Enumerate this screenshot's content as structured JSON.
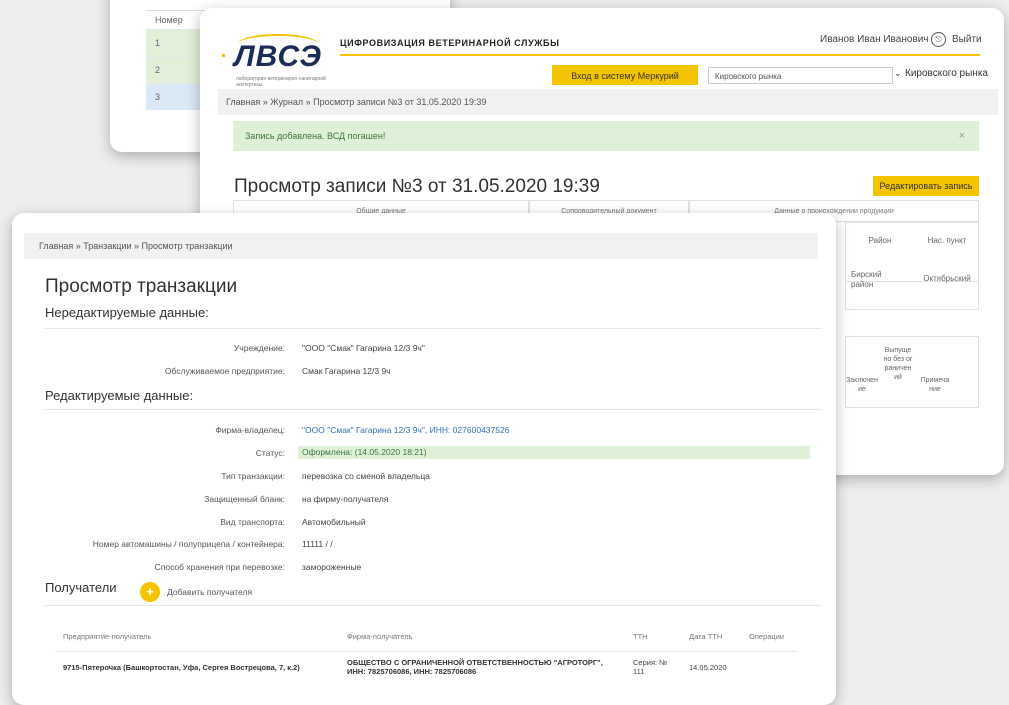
{
  "back_card": {
    "header": "Номер",
    "rows": [
      "1",
      "2",
      "3"
    ]
  },
  "middle_card": {
    "logo": {
      "text": "ЛВСЭ",
      "subtitle": "лаборатория ветеринарно-санитарной экспертизы"
    },
    "app_title": "ЦИФРОВИЗАЦИЯ ВЕТЕРИНАРНОЙ СЛУЖБЫ",
    "user_name": "Иванов Иван Иванович",
    "logout_label": "Выйти",
    "mercury_button": "Вход в систему Меркурий",
    "market_select_value": "Кировского рынка",
    "market_label": "Кировского рынка",
    "breadcrumb": "Главная  »  Журнал  »  Просмотр записи №3 от 31.05.2020 19:39",
    "alert": "Запись добавлена. ВСД погашен!",
    "alert_close": "×",
    "heading": "Просмотр записи №3 от 31.05.2020 19:39",
    "edit_button": "Редактировать запись",
    "table": {
      "group_headers": [
        "Общие данные",
        "Сопроводительный документ",
        "Данные о происхождении продукции"
      ],
      "col_region": "Район",
      "col_settlement": "Нас. пункт",
      "row_region": "Бирский район",
      "row_settlement": "Октябрьский",
      "col_conclusion": "Заключение",
      "col_released": "Выпущено без ограничений",
      "col_note": "Примечание"
    }
  },
  "front_card": {
    "breadcrumb": "Главная  »  Транзакции  »  Просмотр транзакции",
    "title": "Просмотр транзакции",
    "noneditable_heading": "Нередактируемые данные:",
    "editable_heading": "Редактируемые данные:",
    "fields": {
      "institution_label": "Учреждение:",
      "institution_value": "\"ООО \"Смак\" Гагарина 12/3 9ч\"",
      "enterprise_label": "Обслуживаемое предприятие:",
      "enterprise_value": "Смак Гагарина 12/3 9ч",
      "owner_label": "Фирма-владелец:",
      "owner_value": "\"ООО \"Смак\" Гагарина 12/3 9ч\", ИНН: 027600437526",
      "status_label": "Статус:",
      "status_value": "Оформлена: (14.05.2020 18:21)",
      "type_label": "Тип транзакции:",
      "type_value": "перевозка со сменой владельца",
      "blank_label": "Защищенный бланк:",
      "blank_value": "на фирму-получателя",
      "transport_label": "Вид транспорта:",
      "transport_value": "Автомобильный",
      "vehicle_label": "Номер автомашины / полуприцепа / контейнера:",
      "vehicle_value": "11111 / /",
      "storage_label": "Способ хранения при перевозке:",
      "storage_value": "замороженные"
    },
    "recipients_title": "Получатели",
    "add_recipient": "Добавить получателя",
    "add_icon": "+",
    "recipients_table": {
      "headers": [
        "Предприятие-получатель",
        "Фирма-получатель",
        "ТТН",
        "Дата ТТН",
        "Операции"
      ],
      "rows": [
        [
          "9715-Пятерочка (Башкортостан, Уфа, Сергея Вострецова, 7, к.2)",
          "ОБЩЕСТВО С ОГРАНИЧЕННОЙ ОТВЕТСТВЕННОСТЬЮ \"АГРОТОРГ\", ИНН: 7825706086, ИНН: 7825706086",
          "Серия: № 111",
          "14.05.2020",
          ""
        ]
      ]
    }
  }
}
